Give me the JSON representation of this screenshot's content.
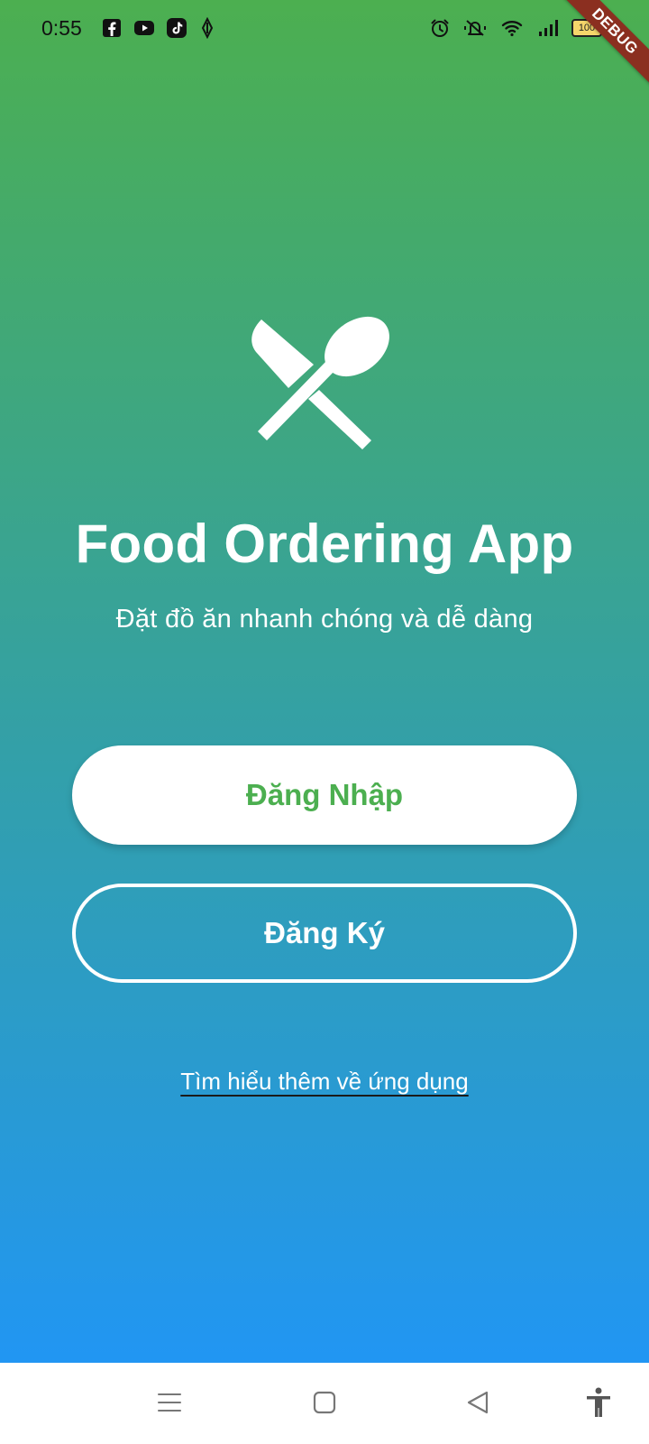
{
  "status_bar": {
    "time": "0:55",
    "battery": "100",
    "left_icons": [
      "facebook-icon",
      "youtube-icon",
      "tiktok-icon",
      "navigation-icon"
    ],
    "right_icons": [
      "alarm-icon",
      "vibrate-icon",
      "wifi-icon",
      "signal-icon",
      "battery-icon"
    ]
  },
  "debug_banner": "DEBUG",
  "app": {
    "logo_icon": "restaurant-icon",
    "title": "Food Ordering App",
    "subtitle": "Đặt đồ ăn nhanh chóng và dễ dàng"
  },
  "actions": {
    "login_label": "Đăng Nhập",
    "register_label": "Đăng Ký",
    "learn_more_label": "Tìm hiểu thêm về ứng dụng"
  },
  "colors": {
    "gradient_top": "#4CAF50",
    "gradient_bottom": "#2196F3",
    "login_text": "#4CAF50",
    "debug_ribbon": "#8B2F20"
  },
  "nav_bar": {
    "buttons": [
      "menu-icon",
      "home-icon",
      "back-icon",
      "accessibility-icon"
    ]
  }
}
